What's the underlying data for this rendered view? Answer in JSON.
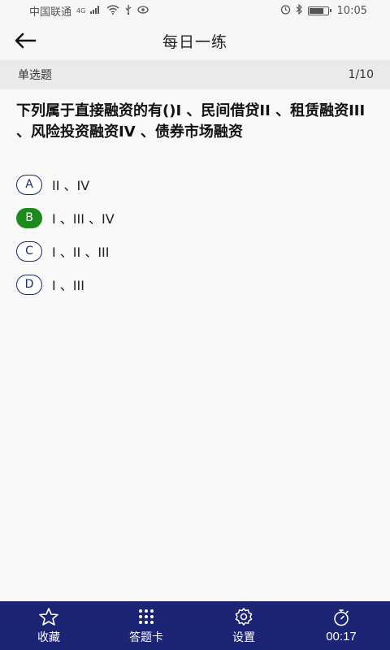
{
  "status_bar": {
    "carrier": "中国联通",
    "network": "4G",
    "time": "10:05"
  },
  "header": {
    "title": "每日一练"
  },
  "question_meta": {
    "type": "单选题",
    "progress": "1/10"
  },
  "question": {
    "text": "下列属于直接融资的有()I 、民间借贷II 、租赁融资III 、风险投资融资IV 、债券市场融资",
    "selected": "B",
    "options": [
      {
        "letter": "A",
        "text": "II 、IV"
      },
      {
        "letter": "B",
        "text": "I 、III 、IV"
      },
      {
        "letter": "C",
        "text": "I 、II 、III"
      },
      {
        "letter": "D",
        "text": "I 、III"
      }
    ]
  },
  "bottom_bar": {
    "favorite_label": "收藏",
    "answer_card_label": "答题卡",
    "settings_label": "设置",
    "timer": "00:17"
  },
  "colors": {
    "bottom_bar_bg": "#1c2475",
    "selected_option": "#1e8a1e",
    "option_border": "#1a2a6b"
  }
}
